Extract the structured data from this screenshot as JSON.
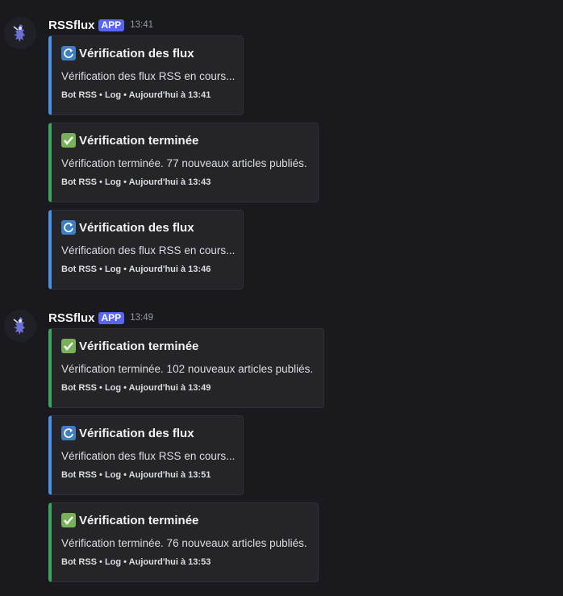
{
  "colors": {
    "background": "#1a1a1e",
    "embed_bg": "#242429",
    "running_accent": "#4a90e2",
    "done_accent": "#3ba55c",
    "badge": "#5865f2"
  },
  "groups": [
    {
      "username": "RSSflux",
      "badge": "APP",
      "time": "13:41",
      "avatar_icon": "ninja-avatar-icon",
      "embeds": [
        {
          "status": "running",
          "icon": "refresh-icon",
          "title": "Vérification des flux",
          "description": "Vérification des flux RSS en cours...",
          "footer": "Bot RSS • Log • Aujourd'hui à 13:41"
        },
        {
          "status": "done",
          "icon": "check-icon",
          "title": "Vérification terminée",
          "description": "Vérification terminée. 77 nouveaux articles publiés.",
          "footer": "Bot RSS • Log • Aujourd'hui à 13:43"
        },
        {
          "status": "running",
          "icon": "refresh-icon",
          "title": "Vérification des flux",
          "description": "Vérification des flux RSS en cours...",
          "footer": "Bot RSS • Log • Aujourd'hui à 13:46"
        }
      ]
    },
    {
      "username": "RSSflux",
      "badge": "APP",
      "time": "13:49",
      "avatar_icon": "ninja-avatar-icon",
      "embeds": [
        {
          "status": "done",
          "icon": "check-icon",
          "title": "Vérification terminée",
          "description": "Vérification terminée. 102 nouveaux articles publiés.",
          "footer": "Bot RSS • Log • Aujourd'hui à 13:49"
        },
        {
          "status": "running",
          "icon": "refresh-icon",
          "title": "Vérification des flux",
          "description": "Vérification des flux RSS en cours...",
          "footer": "Bot RSS • Log • Aujourd'hui à 13:51"
        },
        {
          "status": "done",
          "icon": "check-icon",
          "title": "Vérification terminée",
          "description": "Vérification terminée. 76 nouveaux articles publiés.",
          "footer": "Bot RSS • Log • Aujourd'hui à 13:53"
        }
      ]
    }
  ]
}
